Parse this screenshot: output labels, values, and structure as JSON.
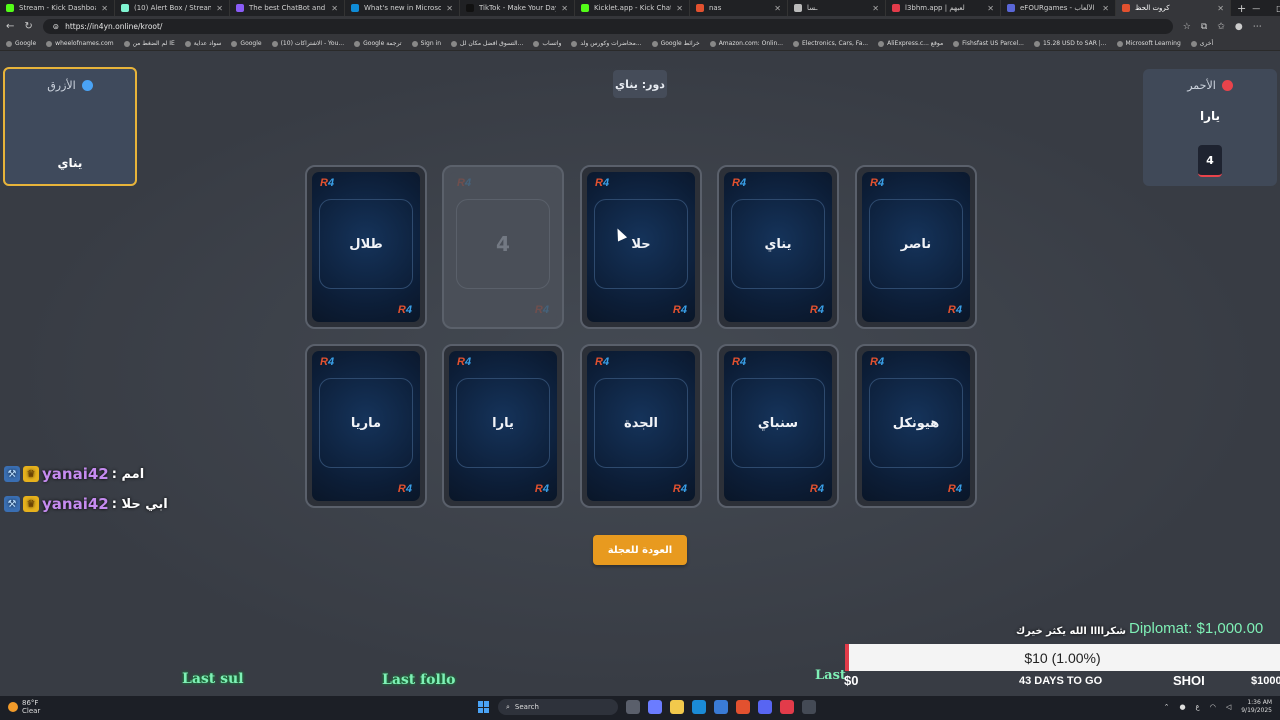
{
  "browser": {
    "tabs": [
      {
        "title": "Stream - Kick Dashboard",
        "color": "#53fc18"
      },
      {
        "title": "(10) Alert Box / Streamlabs",
        "color": "#80f5d2"
      },
      {
        "title": "The best ChatBot and Widgets",
        "color": "#8a5cf6"
      },
      {
        "title": "What's new in Microsoft Edge",
        "color": "#0f8bd6"
      },
      {
        "title": "TikTok - Make Your Day",
        "color": "#111111"
      },
      {
        "title": "Kicklet.app - Kick Chatbot and",
        "color": "#53fc18"
      },
      {
        "title": "nas",
        "color": "#e2512f"
      },
      {
        "title": "ـسا",
        "color": "#bbbbbb"
      },
      {
        "title": "l3bhm.app | لعبهم",
        "color": "#e23b4a"
      },
      {
        "title": "eFOURgames - الألعاب",
        "color": "#5a67d8"
      },
      {
        "title": "كروت الحظ",
        "color": "#e2512f"
      }
    ],
    "new_tab": "+",
    "url": "https://in4yn.online/kroot/",
    "bookmarks": [
      "Google",
      "wheelofnames.com",
      "لم الضغط من IE",
      "سواد عداية",
      "Google",
      "(10) الاشتراكات - You...",
      "Google ترجمة",
      "Sign in",
      "التسوق افضل مكان لل...",
      "واتساب",
      "محاضرات وكورس ولد...",
      "Google خرائط",
      "Amazon.com: Onlin...",
      "Electronics, Cars, Fa...",
      "AliExpress.c... موقع",
      "Fishsfast US Parcel...",
      "15.28 USD to SAR |...",
      "Microsoft Learning",
      "أخرى"
    ]
  },
  "game": {
    "turn_label": "دور: يناي",
    "blue_team": {
      "label": "الأزرق",
      "member": "يناي",
      "color": "#4aa3f5"
    },
    "red_team": {
      "label": "الأحمر",
      "member": "يارا",
      "score": "4",
      "color": "#e8434b"
    },
    "cards_row1": [
      {
        "name": "طلال",
        "revealed": false
      },
      {
        "name": "4",
        "revealed": true
      },
      {
        "name": "حلا",
        "revealed": false
      },
      {
        "name": "يناي",
        "revealed": false
      },
      {
        "name": "ناصر",
        "revealed": false
      }
    ],
    "cards_row2": [
      {
        "name": "ماريا",
        "revealed": false
      },
      {
        "name": "يارا",
        "revealed": false
      },
      {
        "name": "الجدة",
        "revealed": false
      },
      {
        "name": "سنباي",
        "revealed": false
      },
      {
        "name": "هيونكل",
        "revealed": false
      }
    ],
    "logo_r": "R",
    "logo_f": "4",
    "back_button": "العودة للعجلة"
  },
  "chat": [
    {
      "user": "yanai42",
      "message": ": امم"
    },
    {
      "user": "yanai42",
      "message": ": ابي حلا"
    }
  ],
  "widgets": {
    "last_sub": "Last sul",
    "last_follow": "Last follo",
    "last_other": "Last",
    "thanks": "شكراااا الله يكثر خيرك",
    "diplomat": "Diplomat: $1,000.00",
    "goal_text": "$10 (1.00%)",
    "goal_percent": 1,
    "goal_min": "$0",
    "goal_days": "43 DAYS TO GO",
    "goal_show": "SHOI",
    "goal_max": "$1000"
  },
  "taskbar": {
    "temp": "86°F",
    "weather": "Clear",
    "search": "Search",
    "time": "1:36 AM",
    "date": "9/19/2025"
  }
}
